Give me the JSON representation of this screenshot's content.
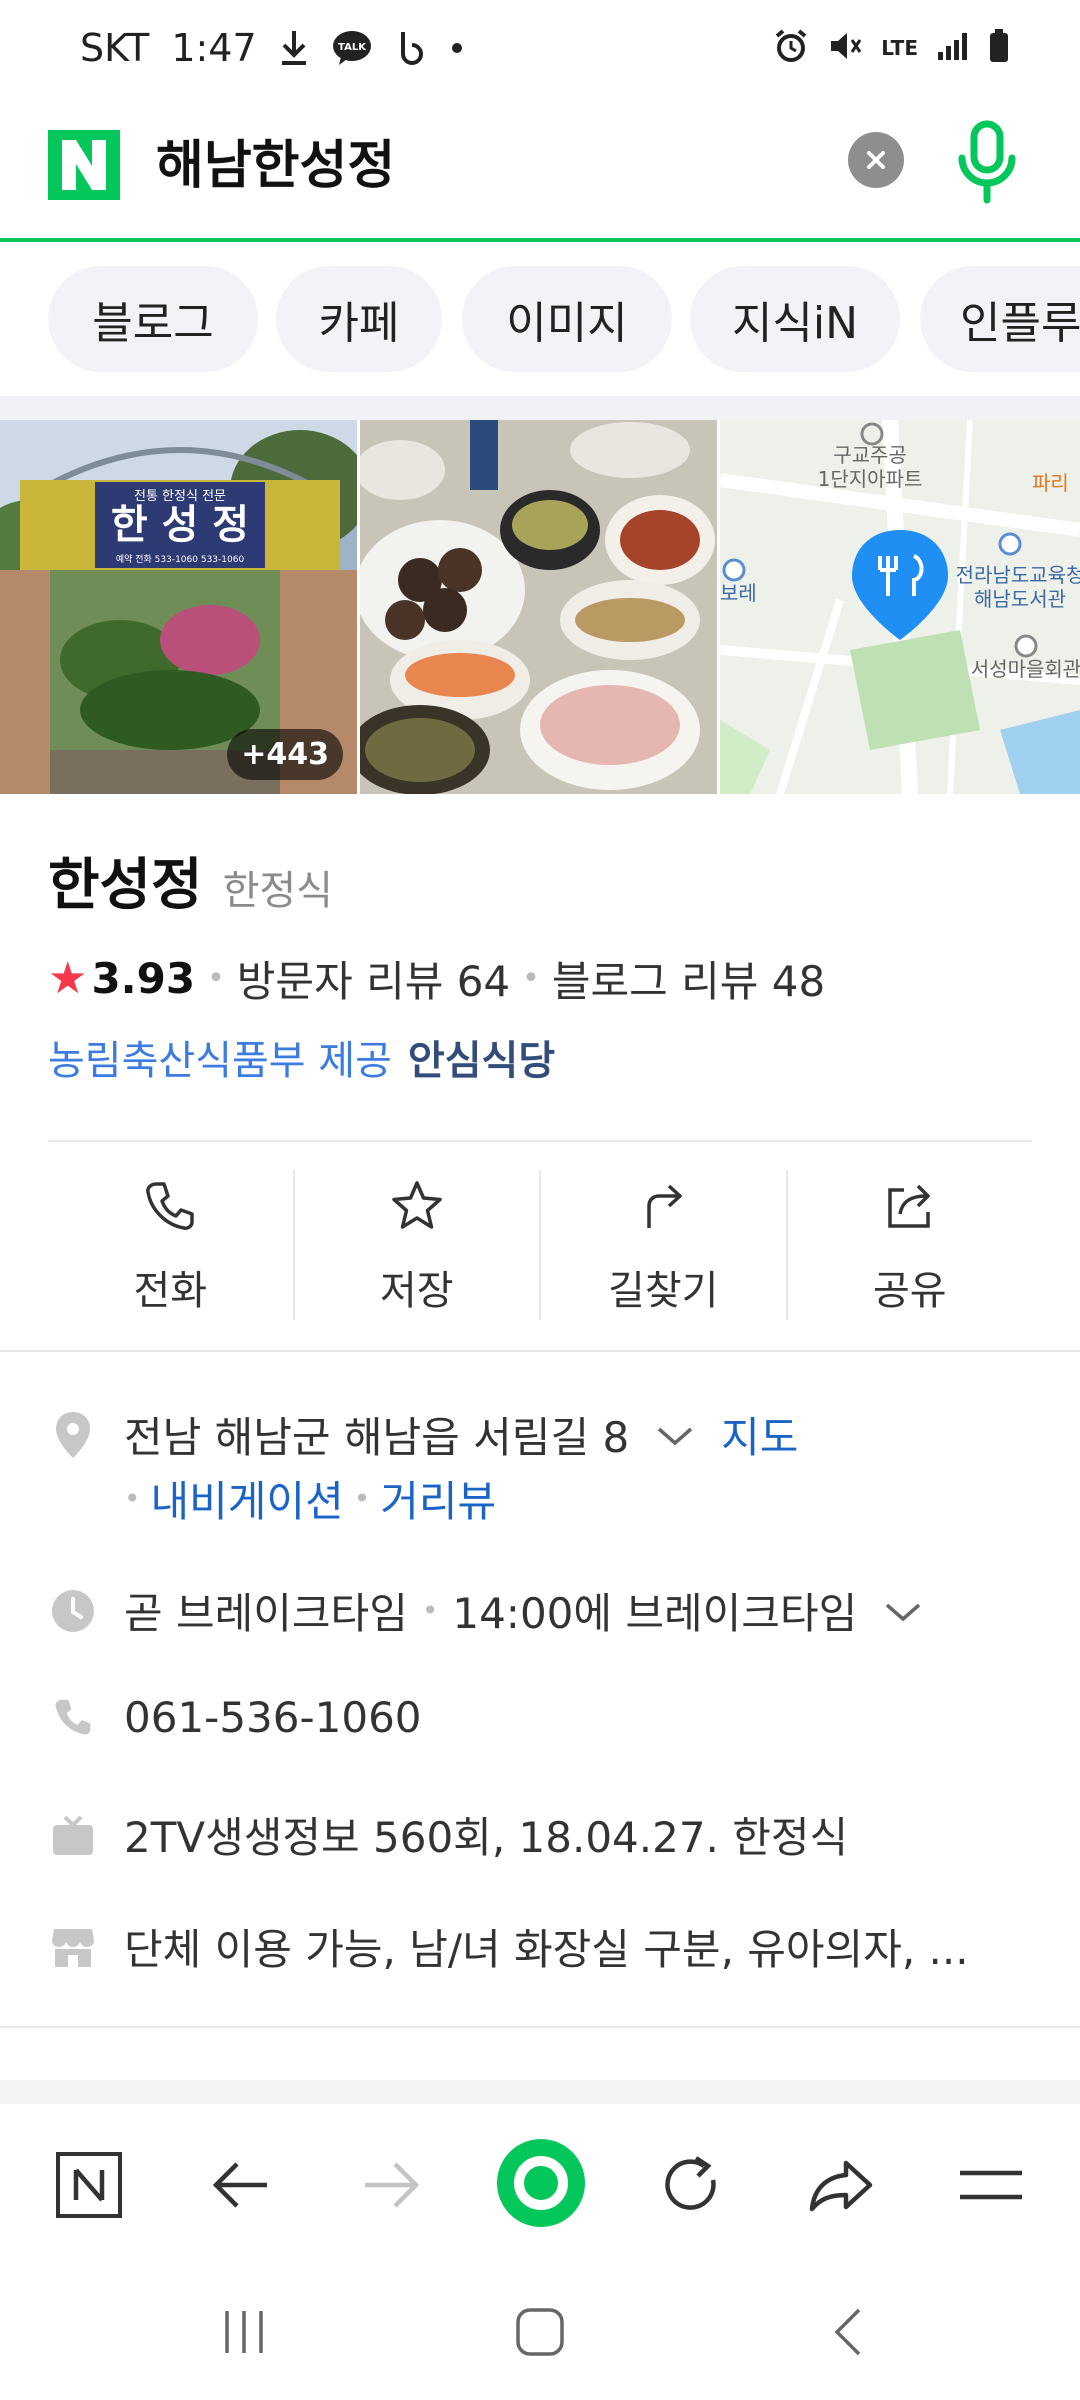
{
  "status_bar": {
    "carrier": "SKT",
    "time": "1:47",
    "talk_badge": "TALK",
    "network": "LTE"
  },
  "search": {
    "query": "해남한성정",
    "logo_letter": "N",
    "brand_color": "#03c75a"
  },
  "tabs": [
    "블로그",
    "카페",
    "이미지",
    "지식iN",
    "인플루"
  ],
  "photos": {
    "more_count": "+443"
  },
  "place": {
    "name": "한성정",
    "category": "한정식",
    "rating_star": "★",
    "rating": "3.93",
    "visitor_reviews": "방문자 리뷰 64",
    "blog_reviews": "블로그 리뷰 48",
    "provider": "농림축산식품부 제공",
    "safe_label": "안심식당"
  },
  "actions": [
    {
      "label": "전화",
      "icon": "phone-icon"
    },
    {
      "label": "저장",
      "icon": "star-icon"
    },
    {
      "label": "길찾기",
      "icon": "directions-icon"
    },
    {
      "label": "공유",
      "icon": "share-icon"
    }
  ],
  "info": {
    "address": "전남 해남군 해남읍 서림길 8",
    "map_link": "지도",
    "navigation_link": "내비게이션",
    "streetview_link": "거리뷰",
    "hours_status": "곧 브레이크타임",
    "hours_detail": "14:00에 브레이크타임",
    "phone": "061-536-1060",
    "tv": "2TV생생정보 560회, 18.04.27. 한정식",
    "amenities": "단체 이용 가능, 남/녀 화장실 구분, 유아의자, ..."
  },
  "photo_sign": {
    "title": "한 성 정",
    "line1": "전통 한정식 전문",
    "line2": "예약 전화 533-1060 533-1060"
  },
  "map_labels": {
    "label1": "구교주공",
    "label2": "1단지아파트",
    "label3": "전라남도교육청",
    "label4": "해남도서관",
    "label5": "서성마을회관",
    "label6": "파리",
    "label7": "보레"
  }
}
